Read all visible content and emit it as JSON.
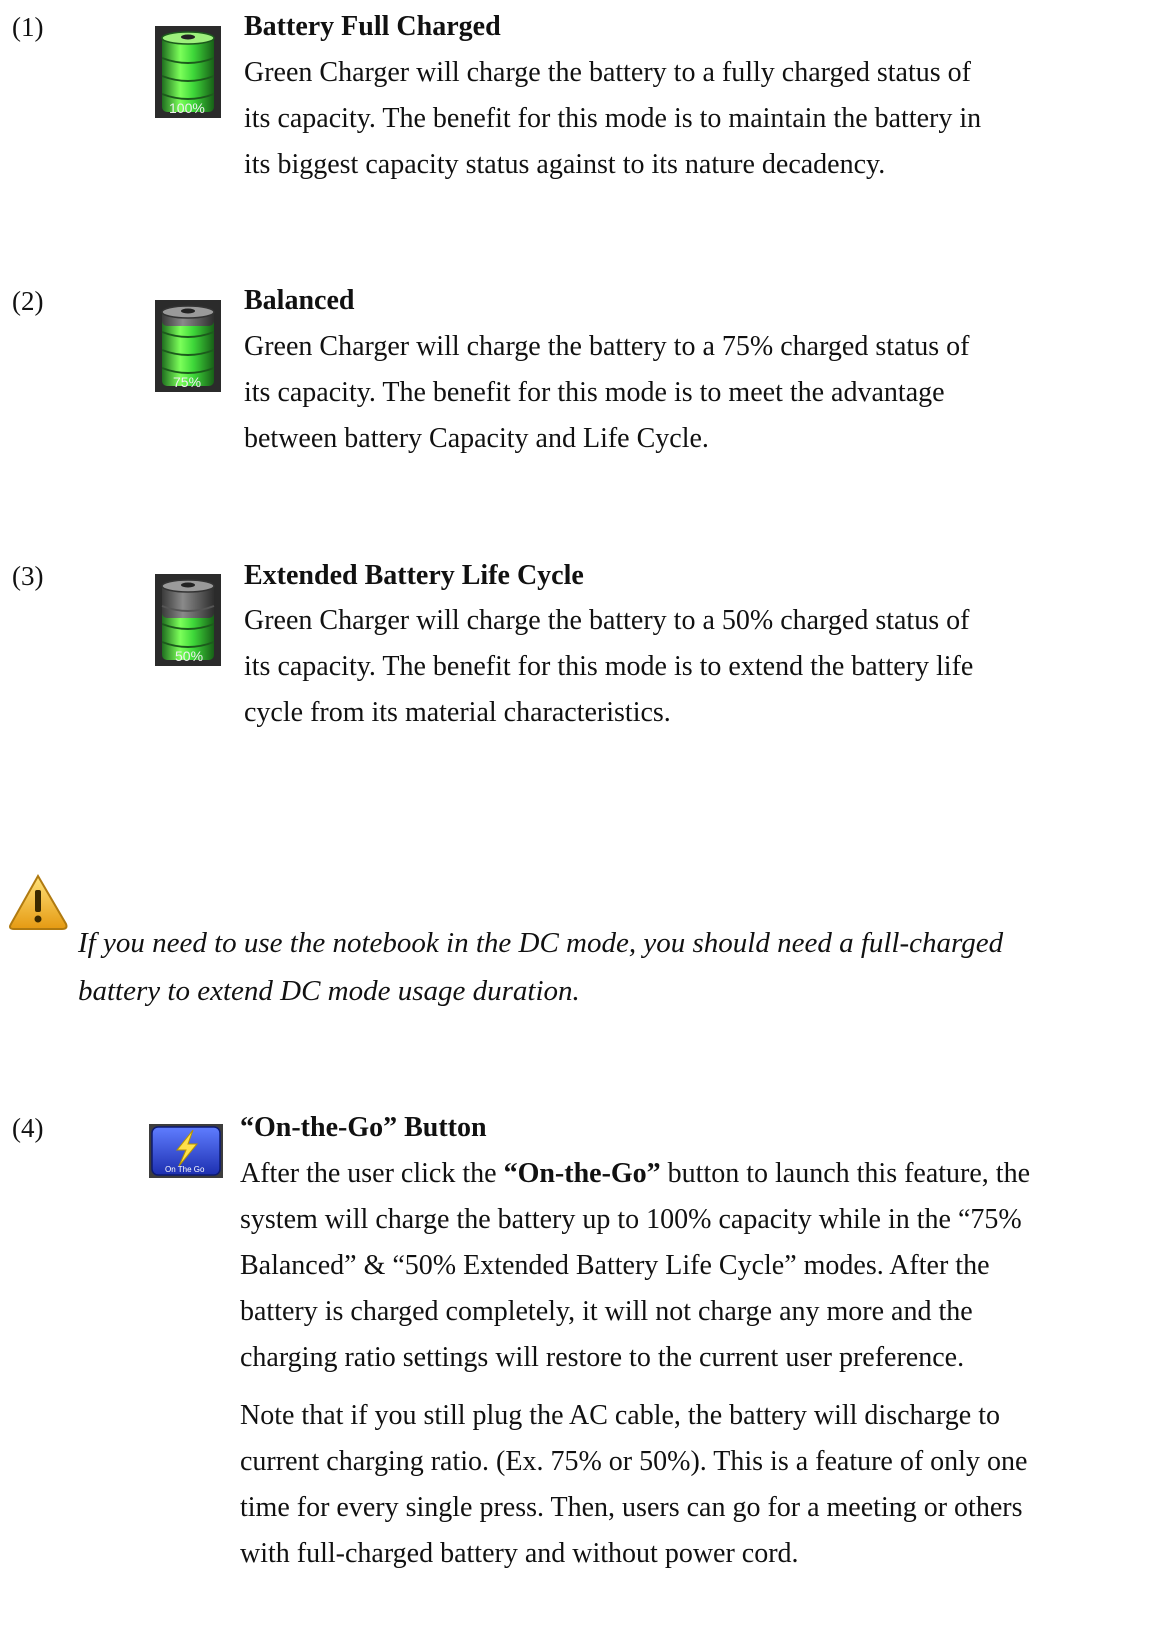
{
  "sections": [
    {
      "number": "(1)",
      "title": "Battery Full Charged",
      "icon": "battery-100-icon",
      "icon_label": "100%",
      "lines": [
        "Green Charger will charge the battery to a fully charged status of",
        "its capacity. The benefit for this mode is to maintain the battery in",
        "its biggest capacity status against to its nature decadency."
      ]
    },
    {
      "number": "(2)",
      "title": "Balanced",
      "icon": "battery-75-icon",
      "icon_label": "75%",
      "lines": [
        "Green Charger will charge the battery to a 75% charged status of",
        "its capacity. The benefit for this mode is to meet the advantage",
        "between battery Capacity and Life Cycle."
      ]
    },
    {
      "number": "(3)",
      "title": "Extended Battery Life Cycle",
      "icon": "battery-50-icon",
      "icon_label": "50%",
      "lines": [
        "Green Charger will charge the battery to a 50% charged status of",
        "its capacity. The benefit for this mode is to extend the battery life",
        "cycle from its material characteristics."
      ]
    }
  ],
  "note": {
    "icon": "warning-icon",
    "lines": [
      "If you need to use the notebook in the DC mode, you should need a full-charged",
      "battery to extend DC mode usage duration."
    ]
  },
  "section4": {
    "number": "(4)",
    "title": "“On-the-Go” Button",
    "icon": "on-the-go-button-icon",
    "icon_label": "On The Go",
    "p1_first_before": "After the user click the ",
    "p1_first_bold": "“On-the-Go”",
    "p1_first_after": " button to launch this feature, the",
    "p1_lines": [
      "system will charge the battery up to 100% capacity while in the “75%",
      "Balanced” & “50% Extended Battery Life Cycle” modes. After the",
      "battery is charged completely, it will not charge any more and the",
      "charging ratio settings will restore to the current user preference."
    ],
    "p2_lines": [
      "Note that if you still plug the AC cable, the battery will discharge to",
      "current charging ratio. (Ex. 75% or 50%). This is a feature of only one",
      "time for every single press. Then, users can go for a meeting or others",
      "with full-charged battery and without power cord."
    ]
  }
}
